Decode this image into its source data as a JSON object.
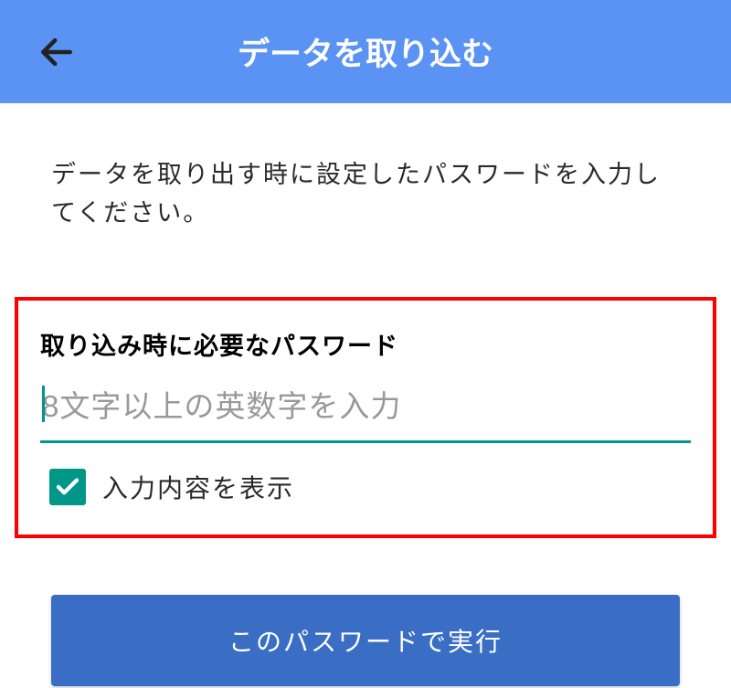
{
  "header": {
    "title": "データを取り込む"
  },
  "instruction": "データを取り出す時に設定したパスワードを入力してください。",
  "password": {
    "label": "取り込み時に必要なパスワード",
    "placeholder": "8文字以上の英数字を入力",
    "value": ""
  },
  "checkbox": {
    "label": "入力内容を表示",
    "checked": true
  },
  "submit": {
    "label": "このパスワードで実行"
  },
  "colors": {
    "header_bg": "#5b93f5",
    "accent": "#009688",
    "button_bg": "#3a6dc4",
    "highlight_border": "#ff0000"
  }
}
